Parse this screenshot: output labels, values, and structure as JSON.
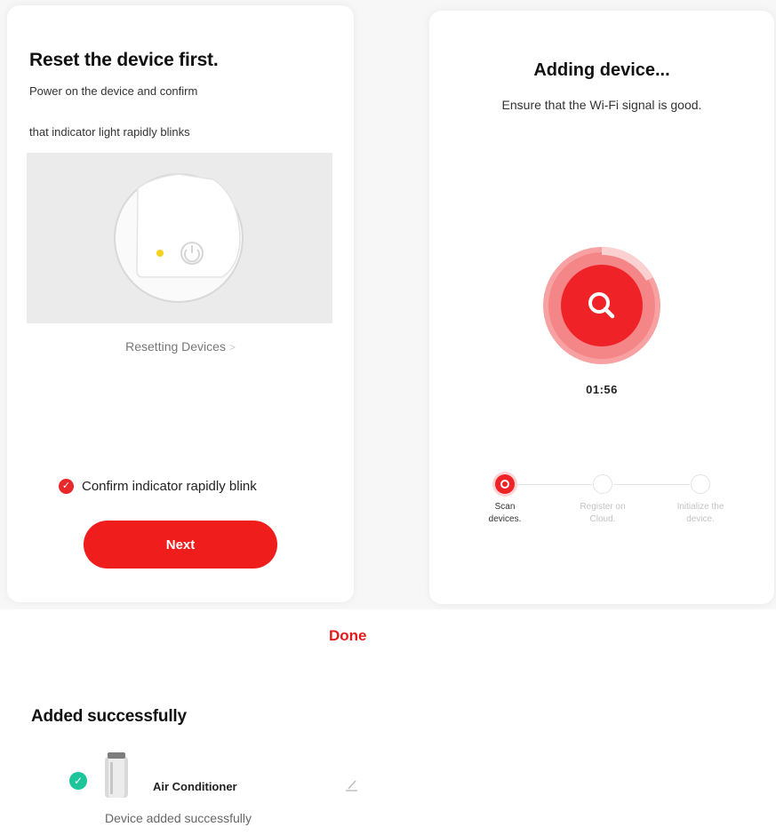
{
  "reset_panel": {
    "title": "Reset the device first.",
    "instruction_line1": "Power on the device and confirm",
    "instruction_line2": "that indicator light rapidly blinks",
    "resetting_link": "Resetting Devices",
    "link_chevron": ">",
    "confirm_label": "Confirm indicator rapidly blink",
    "confirm_checked": true,
    "next_label": "Next",
    "icons": [
      "device-illustration",
      "power-icon",
      "indicator-dot",
      "check-circle-icon",
      "chevron-right-icon"
    ]
  },
  "adding_panel": {
    "title": "Adding device...",
    "subtitle": "Ensure that the Wi-Fi signal is good.",
    "timer": "01:56",
    "progress_ring_fraction": 0.15,
    "steps": [
      {
        "label_line1": "Scan",
        "label_line2": "devices.",
        "active": true
      },
      {
        "label_line1": "Register on",
        "label_line2": "Cloud.",
        "active": false
      },
      {
        "label_line1": "Initialize the",
        "label_line2": "device.",
        "active": false
      }
    ],
    "icons": [
      "search-icon"
    ]
  },
  "success_panel": {
    "done_label": "Done",
    "title": "Added successfully",
    "device_name": "Air Conditioner",
    "device_status": "Device added successfully",
    "icons": [
      "green-check-icon",
      "air-conditioner-icon",
      "edit-pencil-icon"
    ]
  },
  "colors": {
    "accent_red": "#f01d1d",
    "success_green": "#1fc59a",
    "indicator_yellow": "#f6d21c"
  }
}
